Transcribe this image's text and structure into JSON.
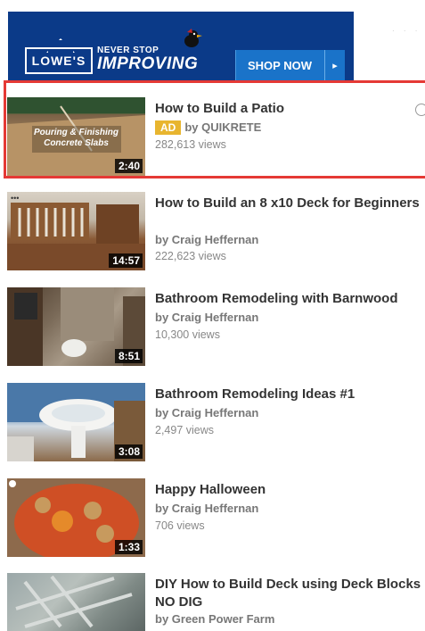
{
  "banner": {
    "brand": "LOWE'S",
    "slogan_small": "NEVER STOP",
    "slogan_big": "IMPROVING",
    "cta": "SHOP NOW",
    "cta_arrow": "▸",
    "color_bg": "#0b3a88",
    "color_cta": "#1a73c9"
  },
  "videos": [
    {
      "title": "How to Build a Patio",
      "is_ad": true,
      "ad_label": "AD",
      "channel": "by QUIKRETE",
      "views": "282,613 views",
      "duration": "2:40",
      "thumb_caption": "Pouring & Finishing Concrete Slabs"
    },
    {
      "title": "How to Build an 8 x10 Deck for Beginners",
      "channel": "by Craig Heffernan",
      "views": "222,623 views",
      "duration": "14:57"
    },
    {
      "title": "Bathroom Remodeling with Barnwood",
      "channel": "by Craig Heffernan",
      "views": "10,300 views",
      "duration": "8:51"
    },
    {
      "title": "Bathroom Remodeling Ideas #1",
      "channel": "by Craig Heffernan",
      "views": "2,497 views",
      "duration": "3:08"
    },
    {
      "title": "Happy Halloween",
      "channel": "by Craig Heffernan",
      "views": "706 views",
      "duration": "1:33"
    },
    {
      "title": "DIY How to Build Deck using Deck Blocks NO DIG",
      "channel": "by Green Power Farm",
      "views": ""
    }
  ],
  "colors": {
    "highlight": "#e53935",
    "ad_badge": "#e8b52f"
  }
}
